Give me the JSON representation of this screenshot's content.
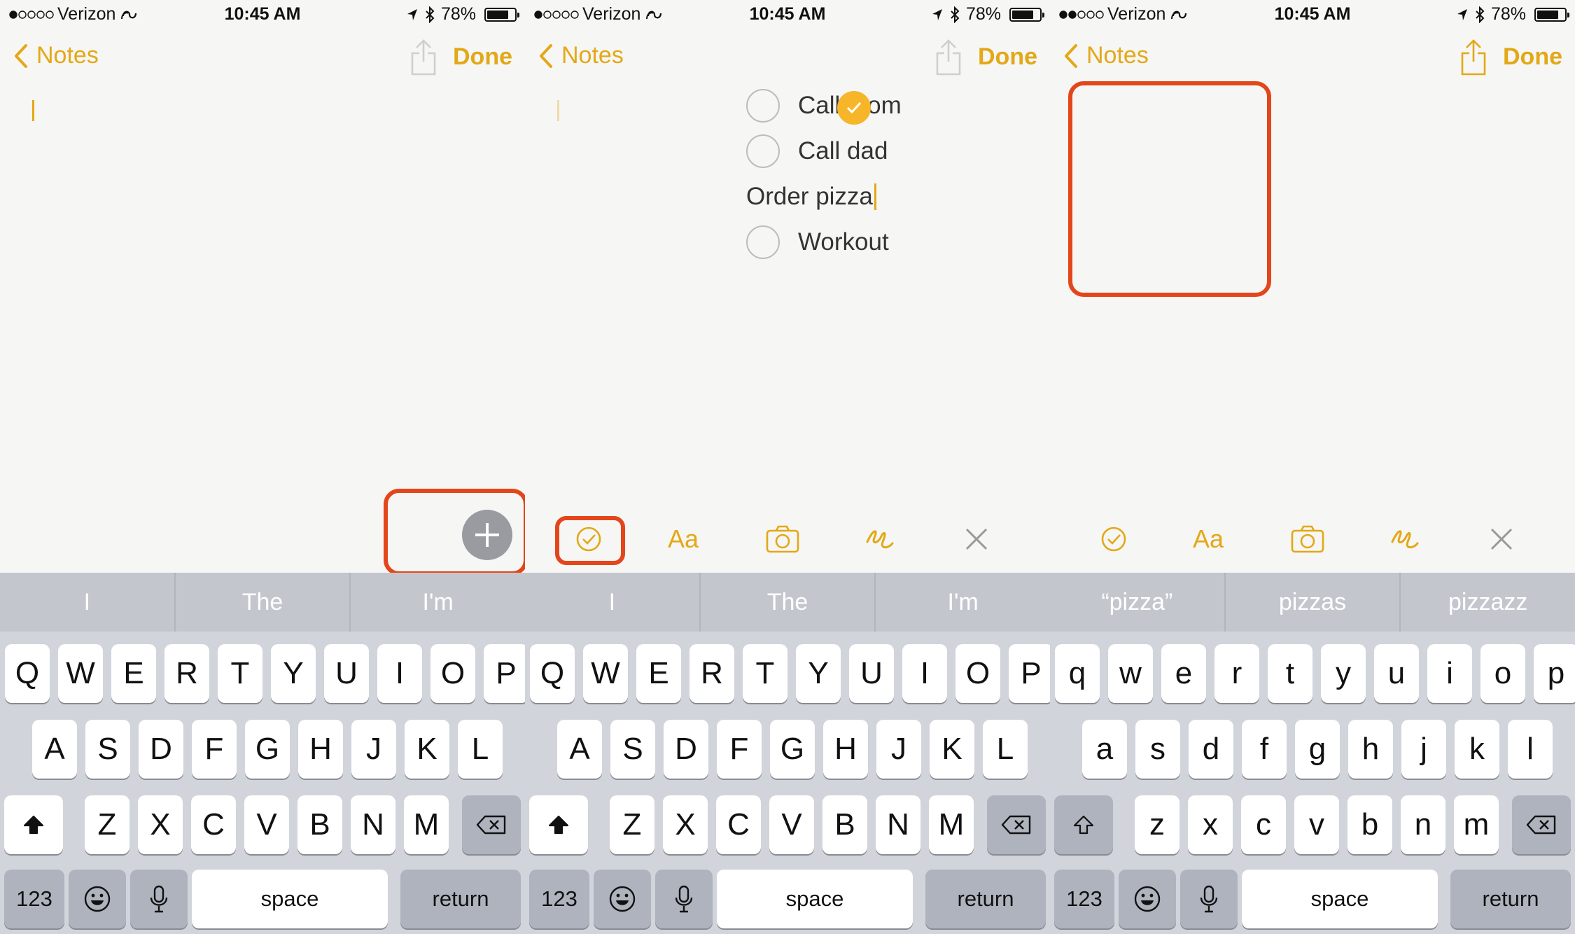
{
  "status_bar": {
    "carrier": "Verizon",
    "time": "10:45 AM",
    "battery": "78%",
    "battery_level": 0.78
  },
  "nav": {
    "back_label": "Notes",
    "done_label": "Done"
  },
  "accent_color": "#e3a817",
  "highlight_color": "#e3461b",
  "toolbar_icons": [
    "checklist-icon",
    "text-format-icon",
    "camera-icon",
    "sketch-icon",
    "close-icon",
    "add-icon"
  ],
  "panels": [
    {
      "suggestions": [
        "I",
        "The",
        "I'm"
      ],
      "signal_bars": 1
    },
    {
      "suggestions": [
        "I",
        "The",
        "I'm"
      ],
      "signal_bars": 1
    },
    {
      "suggestions": [
        "“pizza”",
        "pizzas",
        "pizzazz"
      ],
      "signal_bars": 2
    }
  ],
  "checklist": [
    {
      "text": "Call mom",
      "checked": false
    },
    {
      "text": "Call dad",
      "checked": false
    },
    {
      "text": "Order pizza",
      "checked": true
    },
    {
      "text": "Workout",
      "checked": false
    }
  ],
  "keyboard": {
    "upper_rows": [
      [
        "Q",
        "W",
        "E",
        "R",
        "T",
        "Y",
        "U",
        "I",
        "O",
        "P"
      ],
      [
        "A",
        "S",
        "D",
        "F",
        "G",
        "H",
        "J",
        "K",
        "L"
      ],
      [
        "Z",
        "X",
        "C",
        "V",
        "B",
        "N",
        "M"
      ]
    ],
    "lower_rows": [
      [
        "q",
        "w",
        "e",
        "r",
        "t",
        "y",
        "u",
        "i",
        "o",
        "p"
      ],
      [
        "a",
        "s",
        "d",
        "f",
        "g",
        "h",
        "j",
        "k",
        "l"
      ],
      [
        "z",
        "x",
        "c",
        "v",
        "b",
        "n",
        "m"
      ]
    ],
    "numbers_label": "123",
    "space_label": "space",
    "return_label": "return"
  }
}
